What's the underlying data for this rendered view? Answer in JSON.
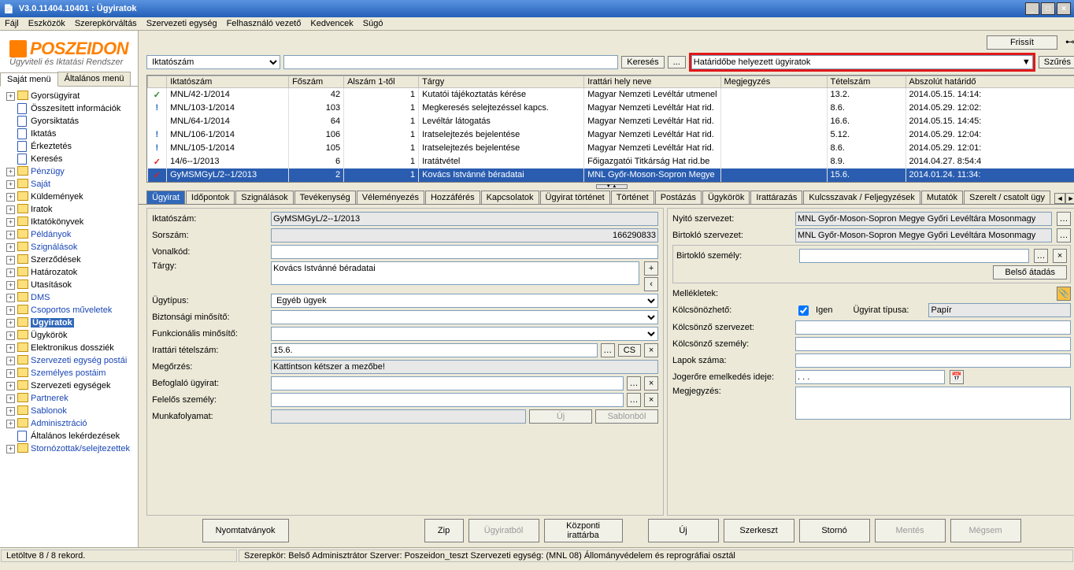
{
  "window": {
    "title": "V3.0.11404.10401 : Ügyiratok"
  },
  "menubar": {
    "file": "Fájl",
    "tools": "Eszközök",
    "role": "Szerepkörváltás",
    "org": "Szervezeti egység",
    "userlead": "Felhasználó vezető",
    "fav": "Kedvencek",
    "help": "Súgó"
  },
  "logo": {
    "text": "POSZEIDON",
    "sub": "Ügyviteli és Iktatási Rendszer"
  },
  "sidemenu_tabs": {
    "own": "Saját menü",
    "general": "Általános menü"
  },
  "tree": {
    "items": [
      {
        "t": "+",
        "label": "Gyorsügyirat",
        "blue": false,
        "sel": false
      },
      {
        "t": "",
        "label": "Összesített információk",
        "blue": false,
        "sel": false
      },
      {
        "t": "",
        "label": "Gyorsiktatás",
        "blue": false,
        "sel": false
      },
      {
        "t": "",
        "label": "Iktatás",
        "blue": false,
        "sel": false
      },
      {
        "t": "",
        "label": "Érkeztetés",
        "blue": false,
        "sel": false
      },
      {
        "t": "",
        "label": "Keresés",
        "blue": false,
        "sel": false
      },
      {
        "t": "+",
        "label": "Pénzügy",
        "blue": true,
        "sel": false
      },
      {
        "t": "+",
        "label": "Saját",
        "blue": true,
        "sel": false
      },
      {
        "t": "+",
        "label": "Küldemények",
        "blue": false,
        "sel": false
      },
      {
        "t": "+",
        "label": "Iratok",
        "blue": false,
        "sel": false
      },
      {
        "t": "+",
        "label": "Iktatókönyvek",
        "blue": false,
        "sel": false
      },
      {
        "t": "+",
        "label": "Példányok",
        "blue": true,
        "sel": false
      },
      {
        "t": "+",
        "label": "Szignálások",
        "blue": true,
        "sel": false
      },
      {
        "t": "+",
        "label": "Szerződések",
        "blue": false,
        "sel": false
      },
      {
        "t": "+",
        "label": "Határozatok",
        "blue": false,
        "sel": false
      },
      {
        "t": "+",
        "label": "Utasítások",
        "blue": false,
        "sel": false
      },
      {
        "t": "+",
        "label": "DMS",
        "blue": true,
        "sel": false
      },
      {
        "t": "+",
        "label": "Csoportos műveletek",
        "blue": true,
        "sel": false
      },
      {
        "t": "+",
        "label": "Ügyiratok",
        "blue": false,
        "sel": true
      },
      {
        "t": "+",
        "label": "Ügykörök",
        "blue": false,
        "sel": false
      },
      {
        "t": "+",
        "label": "Elektronikus dossziék",
        "blue": false,
        "sel": false
      },
      {
        "t": "+",
        "label": "Szervezeti egység postái",
        "blue": true,
        "sel": false
      },
      {
        "t": "+",
        "label": "Személyes postáim",
        "blue": true,
        "sel": false
      },
      {
        "t": "+",
        "label": "Szervezeti egységek",
        "blue": false,
        "sel": false
      },
      {
        "t": "+",
        "label": "Partnerek",
        "blue": true,
        "sel": false
      },
      {
        "t": "+",
        "label": "Sablonok",
        "blue": true,
        "sel": false
      },
      {
        "t": "+",
        "label": "Adminisztráció",
        "blue": true,
        "sel": false
      },
      {
        "t": "",
        "label": "Általános lekérdezések",
        "blue": false,
        "sel": false
      },
      {
        "t": "+",
        "label": "Stornózottak/selejtezettek",
        "blue": true,
        "sel": false
      }
    ]
  },
  "toolbar": {
    "refresh": "Frissít",
    "search": "Keresés",
    "more": "...",
    "filterlabel": "Határidőbe helyezett ügyiratok",
    "filter": "Szűrés",
    "searchcol": "Iktatószám"
  },
  "grid": {
    "headers": [
      "",
      "Iktatószám",
      "Főszám",
      "Alszám 1-től",
      "Tárgy",
      "Irattári hely neve",
      "Megjegyzés",
      "Tételszám",
      "Abszolút határidő"
    ],
    "rows": [
      {
        "mark": "green",
        "c1": "MNL/42-1/2014",
        "c2": "42",
        "c3": "1",
        "c4": "Kutatói tájékoztatás kérése",
        "c5": "Magyar Nemzeti Levéltár utmenel",
        "c6": "",
        "c7": "13.2.",
        "c8": "2014.05.15. 14:14:"
      },
      {
        "mark": "blue",
        "c1": "MNL/103-1/2014",
        "c2": "103",
        "c3": "1",
        "c4": "Megkeresés selejtezéssel kapcs.",
        "c5": "Magyar Nemzeti Levéltár Hat rid.",
        "c6": "",
        "c7": "8.6.",
        "c8": "2014.05.29. 12:02:"
      },
      {
        "mark": "",
        "c1": "MNL/64-1/2014",
        "c2": "64",
        "c3": "1",
        "c4": "Levéltár látogatás",
        "c5": "Magyar Nemzeti Levéltár Hat rid.",
        "c6": "",
        "c7": "16.6.",
        "c8": "2014.05.15. 14:45:"
      },
      {
        "mark": "blue",
        "c1": "MNL/106-1/2014",
        "c2": "106",
        "c3": "1",
        "c4": "Iratselejtezés bejelentése",
        "c5": "Magyar Nemzeti Levéltár Hat rid.",
        "c6": "",
        "c7": "5.12.",
        "c8": "2014.05.29. 12:04:"
      },
      {
        "mark": "blue",
        "c1": "MNL/105-1/2014",
        "c2": "105",
        "c3": "1",
        "c4": "Iratselejtezés bejelentése",
        "c5": "Magyar Nemzeti Levéltár Hat rid.",
        "c6": "",
        "c7": "8.6.",
        "c8": "2014.05.29. 12:01:"
      },
      {
        "mark": "red",
        "c1": "14/6--1/2013",
        "c2": "6",
        "c3": "1",
        "c4": "Iratátvétel",
        "c5": "Főigazgatói Titkárság Hat rid.be",
        "c6": "",
        "c7": "8.9.",
        "c8": "2014.04.27. 8:54:4"
      },
      {
        "mark": "red",
        "c1": "GyMSMGyL/2--1/2013",
        "c2": "2",
        "c3": "1",
        "c4": "Kovács Istvánné béradatai",
        "c5": "MNL Győr-Moson-Sopron Megye",
        "c6": "",
        "c7": "15.6.",
        "c8": "2014.01.24. 11:34:",
        "sel": true
      }
    ]
  },
  "dtabs": [
    "Ügyirat",
    "Időpontok",
    "Szignálások",
    "Tevékenység",
    "Véleményezés",
    "Hozzáférés",
    "Kapcsolatok",
    "Ügyirat történet",
    "Történet",
    "Postázás",
    "Ügykörök",
    "Irattárazás",
    "Kulcsszavak / Feljegyzések",
    "Mutatók",
    "Szerelt / csatolt ügy"
  ],
  "form": {
    "left": {
      "iktato_l": "Iktatószám:",
      "iktato_v": "GyMSMGyL/2--1/2013",
      "sorsz_l": "Sorszám:",
      "sorsz_v": "166290833",
      "vonalkod_l": "Vonalkód:",
      "vonalkod_v": "",
      "targy_l": "Tárgy:",
      "targy_v": "Kovács Istvánné béradatai",
      "ugytipus_l": "Ügytípus:",
      "ugytipus_v": "Egyéb ügyek",
      "bizt_l": "Biztonsági minősítő:",
      "funk_l": "Funkcionális minősítő:",
      "irattari_l": "Irattári tételszám:",
      "irattari_v": "15.6.",
      "cs": "CS",
      "megorzes_l": "Megőrzés:",
      "megorzes_v": "Kattintson kétszer a mezőbe!",
      "befog_l": "Befoglaló ügyirat:",
      "felelos_l": "Felelős személy:",
      "munkaf_l": "Munkafolyamat:",
      "uj": "Új",
      "sablon": "Sablonból"
    },
    "right": {
      "nyito_l": "Nyitó szervezet:",
      "nyito_v": "MNL Győr-Moson-Sopron Megye Győri Levéltára Mosonmagy",
      "birtszerv_l": "Birtokló szervezet:",
      "birtszerv_v": "MNL Győr-Moson-Sopron Megye Győri Levéltára Mosonmagy",
      "birtszem_l": "Birtokló személy:",
      "belso": "Belső átadás",
      "mell_l": "Mellékletek:",
      "kolcson_l": "Kölcsönözhető:",
      "igen": "Igen",
      "ugyirtip_l": "Ügyirat típusa:",
      "ugyirtip_v": "Papír",
      "kolcsszerv_l": "Kölcsönző szervezet:",
      "kolcsszem_l": "Kölcsönző személy:",
      "lapok_l": "Lapok száma:",
      "jogero_l": "Jogerőre emelkedés ideje:",
      "jogero_v": ". . .",
      "megj_l": "Megjegyzés:"
    }
  },
  "bottom": {
    "nyomt": "Nyomtatványok",
    "zip": "Zip",
    "ugyirbol": "Ügyiratból",
    "kozponti": "Központi irattárba",
    "uj": "Új",
    "szerk": "Szerkeszt",
    "storno": "Stornó",
    "mentes": "Mentés",
    "megsem": "Mégsem"
  },
  "status": {
    "rec": "Letöltve 8 / 8 rekord.",
    "full": "Szerepkör: Belső Adminisztrátor   Szerver: Poszeidon_teszt   Szervezeti egység: (MNL 08) Állományvédelem és reprográfiai osztál"
  }
}
